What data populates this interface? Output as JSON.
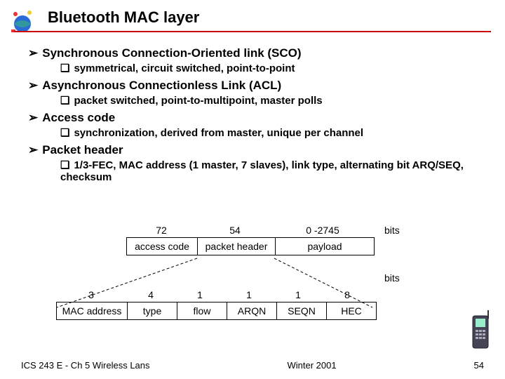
{
  "title": "Bluetooth MAC layer",
  "bullets": [
    {
      "text": "Synchronous Connection-Oriented link (SCO)",
      "sub": [
        "symmetrical, circuit switched, point-to-point"
      ]
    },
    {
      "text": "Asynchronous Connectionless Link (ACL)",
      "sub": [
        "packet switched, point-to-multipoint, master polls"
      ]
    },
    {
      "text": "Access code",
      "sub": [
        "synchronization, derived from master, unique per channel"
      ]
    },
    {
      "text": "Packet header",
      "sub": [
        "1/3-FEC, MAC address (1 master, 7 slaves), link type, alternating bit ARQ/SEQ, checksum"
      ]
    }
  ],
  "diagram": {
    "top_bits_label": "bits",
    "top_numbers": [
      "72",
      "54",
      "0 -2745"
    ],
    "top_fields": [
      "access code",
      "packet header",
      "payload"
    ],
    "bottom_bits_label": "bits",
    "bottom_numbers": [
      "3",
      "4",
      "1",
      "1",
      "1",
      "8"
    ],
    "bottom_fields": [
      "MAC address",
      "type",
      "flow",
      "ARQN",
      "SEQN",
      "HEC"
    ]
  },
  "footer": {
    "left": "ICS 243 E - Ch 5 Wireless Lans",
    "center": "Winter 2001",
    "right": "54"
  }
}
